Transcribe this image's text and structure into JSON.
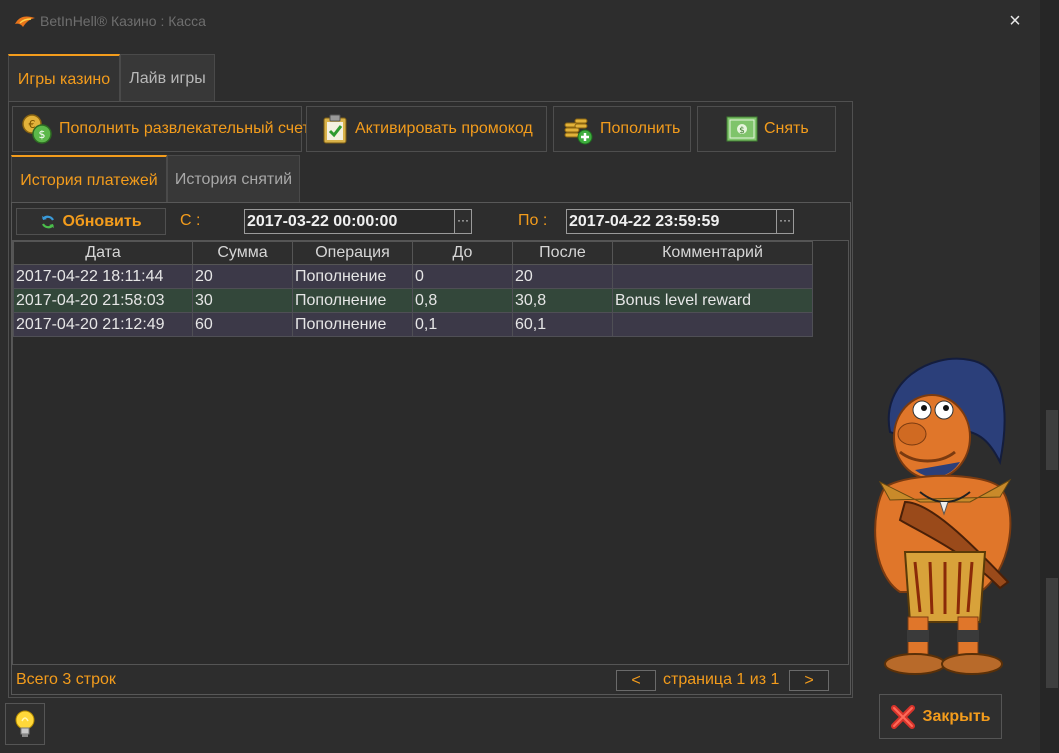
{
  "window": {
    "title": "BetInHell® Казино : Касса",
    "close_glyph": "×"
  },
  "top_tabs": [
    {
      "label": "Игры казино",
      "active": true
    },
    {
      "label": "Лайв игры",
      "active": false
    }
  ],
  "toolbar": {
    "deposit_entertainment_label": "Пополнить развлекательный счет",
    "activate_promo_label": "Активировать промокод",
    "deposit_label": "Пополнить",
    "withdraw_label": "Снять"
  },
  "sub_tabs": [
    {
      "label": "История платежей",
      "active": true
    },
    {
      "label": "История снятий",
      "active": false
    }
  ],
  "filter": {
    "refresh_label": "Обновить",
    "from_label": "С :",
    "from_value": "2017-03-22 00:00:00",
    "to_label": "По :",
    "to_value": "2017-04-22 23:59:59",
    "picker_glyph": "···"
  },
  "table": {
    "columns": [
      "Дата",
      "Сумма",
      "Операция",
      "До",
      "После",
      "Комментарий"
    ],
    "rows": [
      [
        "2017-04-22 18:11:44",
        "20",
        "Пополнение",
        "0",
        "20",
        ""
      ],
      [
        "2017-04-20 21:58:03",
        "30",
        "Пополнение",
        "0,8",
        "30,8",
        "Bonus level reward"
      ],
      [
        "2017-04-20 21:12:49",
        "60",
        "Пополнение",
        "0,1",
        "60,1",
        ""
      ]
    ]
  },
  "footer": {
    "row_count": "Всего 3 строк",
    "prev_label": "<",
    "page_text": "страница 1 из 1",
    "next_label": ">"
  },
  "close_button": {
    "label": "Закрыть"
  },
  "colors": {
    "accent": "#f39c1c",
    "background": "#2d2d2d",
    "row_odd": "#3c3948",
    "row_even": "#33473a"
  },
  "icons": [
    "app-logo-icon",
    "coins-exchange-icon",
    "clipboard-check-icon",
    "coins-plus-icon",
    "banknote-icon",
    "refresh-icon",
    "lightbulb-icon",
    "red-x-icon"
  ]
}
